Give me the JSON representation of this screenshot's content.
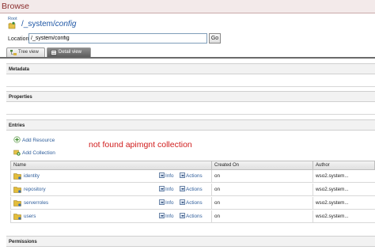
{
  "page": {
    "title": "Browse",
    "root_label": "Root",
    "path_prefix": "/_system/",
    "path_current": "config"
  },
  "location": {
    "label": "Location:",
    "value": "/_system/config",
    "go_label": "Go"
  },
  "tabs": [
    {
      "label": "Tree view",
      "active": false
    },
    {
      "label": "Detail view",
      "active": true
    }
  ],
  "sections": {
    "metadata": "Metadata",
    "properties": "Properties",
    "entries": "Entries",
    "permissions": "Permissions"
  },
  "entries": {
    "add_resource": "Add Resource",
    "add_collection": "Add Collection",
    "note": "not found apimgnt collection",
    "columns": [
      "Name",
      "Created On",
      "Author"
    ],
    "info_label": "Info",
    "actions_label": "Actions",
    "rows": [
      {
        "name": "identity",
        "created_on": "on",
        "author": "wso2.system..."
      },
      {
        "name": "repository",
        "created_on": "on",
        "author": "wso2.system..."
      },
      {
        "name": "serverroles",
        "created_on": "on",
        "author": "wso2.system..."
      },
      {
        "name": "users",
        "created_on": "on",
        "author": "wso2.system..."
      }
    ]
  },
  "colors": {
    "title": "#8a2a2a",
    "link": "#2f5e9b",
    "note": "#d01c1c",
    "active_tab": "#6e6e6e"
  },
  "icons": {
    "root": "home-folder-icon",
    "tree_tab": "tree-icon",
    "detail_tab": "detail-icon",
    "add": "plus-icon",
    "folder": "folder-icon",
    "dropdown": "chevron-down-icon"
  }
}
